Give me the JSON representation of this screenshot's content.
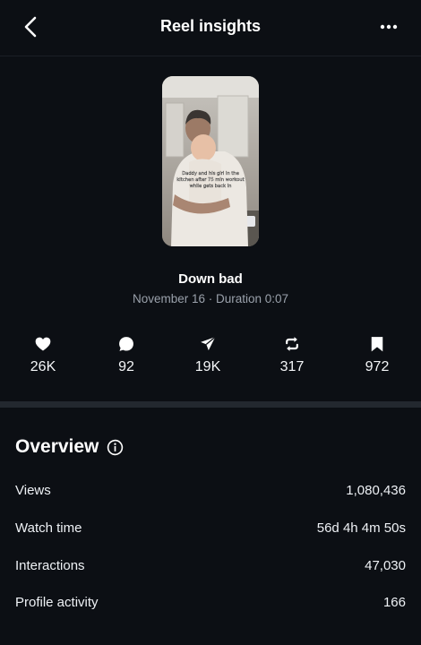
{
  "header": {
    "title": "Reel insights",
    "back_icon": "chevron-left-icon",
    "more_icon": "more-horizontal-icon"
  },
  "reel": {
    "thumbnail_caption": "Daddy and his girl in the kitchen after 75 min workout while gets back in",
    "title": "Down bad",
    "meta": "November 16 · Duration 0:07"
  },
  "stats": [
    {
      "icon": "heart-icon",
      "value": "26K"
    },
    {
      "icon": "comment-icon",
      "value": "92"
    },
    {
      "icon": "share-icon",
      "value": "19K"
    },
    {
      "icon": "repost-icon",
      "value": "317"
    },
    {
      "icon": "bookmark-icon",
      "value": "972"
    }
  ],
  "overview": {
    "title": "Overview",
    "info_icon": "info-icon",
    "rows": [
      {
        "label": "Views",
        "value": "1,080,436"
      },
      {
        "label": "Watch time",
        "value": "56d 4h 4m 50s"
      },
      {
        "label": "Interactions",
        "value": "47,030"
      },
      {
        "label": "Profile activity",
        "value": "166"
      }
    ]
  },
  "colors": {
    "background": "#0c0f14",
    "divider": "#23282f",
    "secondary_text": "#9aa1ab"
  }
}
